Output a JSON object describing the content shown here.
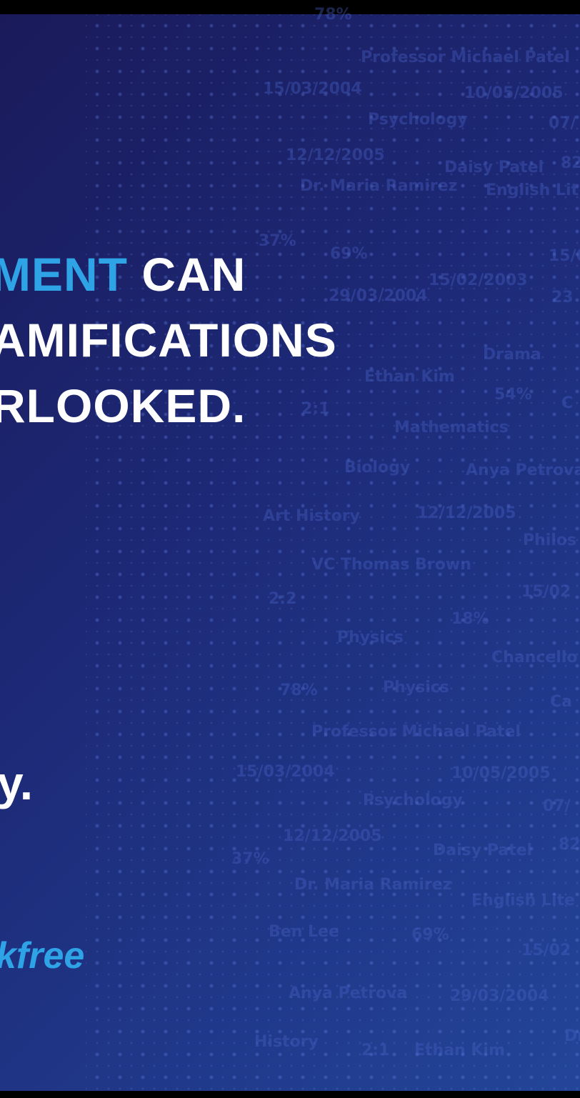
{
  "headline": {
    "accent": "MENT",
    "line1_rest": " CAN",
    "line2": "AMIFICATIONS",
    "line3": "RLOOKED."
  },
  "fragment": "y.",
  "brand": "kfree",
  "colors": {
    "accent": "#2ea3e6",
    "text": "#ffffff",
    "background_start": "#1a1a5a",
    "background_end": "#234599"
  },
  "background_words": [
    "78%",
    "Professor Michael Patel",
    "15/03/2004",
    "10/05/2005",
    "Psychology",
    "07/",
    "12/12/2005",
    "Daisy Patel",
    "82",
    "Dr. Maria Ramirez",
    "English Lit",
    "37%",
    "69%",
    "15/02/2003",
    "15/0",
    "29/03/2004",
    "23",
    "Drama",
    "Ethan Kim",
    "54%",
    "C",
    "2:1",
    "Mathematics",
    "Biology",
    "Anya Petrova",
    "Art History",
    "12/12/2005",
    "Philos",
    "VC Thomas Brown",
    "2:2",
    "15/02",
    "18%",
    "Physics",
    "Chancello",
    "78%",
    "Physics",
    "Ca",
    "Professor Michael Patel",
    "15/03/2004",
    "10/05/2005",
    "Psychology",
    "07/",
    "12/12/2005",
    "Daisy Patel",
    "82",
    "37%",
    "Dr. Maria Ramirez",
    "English Lite",
    "Ben Lee",
    "69%",
    "15/02",
    "Anya Petrova",
    "29/03/2004",
    "Dr",
    "History",
    "2:1",
    "Ethan Kim"
  ]
}
